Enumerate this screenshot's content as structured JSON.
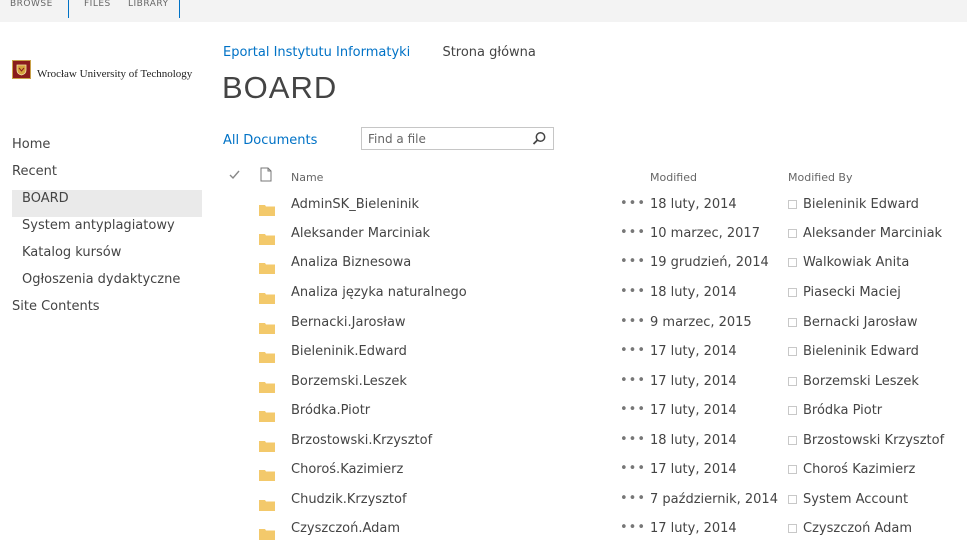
{
  "ribbon": {
    "tabs": [
      "BROWSE",
      "FILES",
      "LIBRARY"
    ]
  },
  "logo": {
    "text": "Wrocław University of Technology"
  },
  "nav": {
    "items": [
      {
        "label": "Home",
        "level": 0,
        "selected": false
      },
      {
        "label": "Recent",
        "level": 0,
        "selected": false
      },
      {
        "label": "BOARD",
        "level": 1,
        "selected": true
      },
      {
        "label": "System antyplagiatowy",
        "level": 1,
        "selected": false
      },
      {
        "label": "Katalog kursów",
        "level": 1,
        "selected": false
      },
      {
        "label": "Ogłoszenia dydaktyczne",
        "level": 1,
        "selected": false
      },
      {
        "label": "Site Contents",
        "level": 0,
        "selected": false
      }
    ]
  },
  "breadcrumb": {
    "site": "Eportal Instytutu Informatyki",
    "home": "Strona główna"
  },
  "page": {
    "title": "BOARD"
  },
  "view": {
    "label": "All Documents"
  },
  "search": {
    "placeholder": "Find a file"
  },
  "table": {
    "columns": {
      "name": "Name",
      "modified": "Modified",
      "modified_by": "Modified By"
    },
    "rows": [
      {
        "name": "AdminSK_Bieleninik",
        "modified": "18 luty, 2014",
        "by": "Bieleninik Edward"
      },
      {
        "name": "Aleksander Marciniak",
        "modified": "10 marzec, 2017",
        "by": "Aleksander Marciniak"
      },
      {
        "name": "Analiza Biznesowa",
        "modified": "19 grudzień, 2014",
        "by": "Walkowiak Anita"
      },
      {
        "name": "Analiza języka naturalnego",
        "modified": "18 luty, 2014",
        "by": "Piasecki Maciej"
      },
      {
        "name": "Bernacki.Jarosław",
        "modified": "9 marzec, 2015",
        "by": "Bernacki Jarosław"
      },
      {
        "name": "Bieleninik.Edward",
        "modified": "17 luty, 2014",
        "by": "Bieleninik Edward"
      },
      {
        "name": "Borzemski.Leszek",
        "modified": "17 luty, 2014",
        "by": "Borzemski Leszek"
      },
      {
        "name": "Bródka.Piotr",
        "modified": "17 luty, 2014",
        "by": "Bródka Piotr"
      },
      {
        "name": "Brzostowski.Krzysztof",
        "modified": "18 luty, 2014",
        "by": "Brzostowski Krzysztof"
      },
      {
        "name": "Choroś.Kazimierz",
        "modified": "17 luty, 2014",
        "by": "Choroś Kazimierz"
      },
      {
        "name": "Chudzik.Krzysztof",
        "modified": "7 październik, 2014",
        "by": "System Account"
      },
      {
        "name": "Czyszczoń.Adam",
        "modified": "17 luty, 2014",
        "by": "Czyszczoń Adam"
      }
    ]
  },
  "colors": {
    "accent": "#0072c6",
    "folder": "#f3c96b",
    "selected_bg": "#eaeaea"
  }
}
